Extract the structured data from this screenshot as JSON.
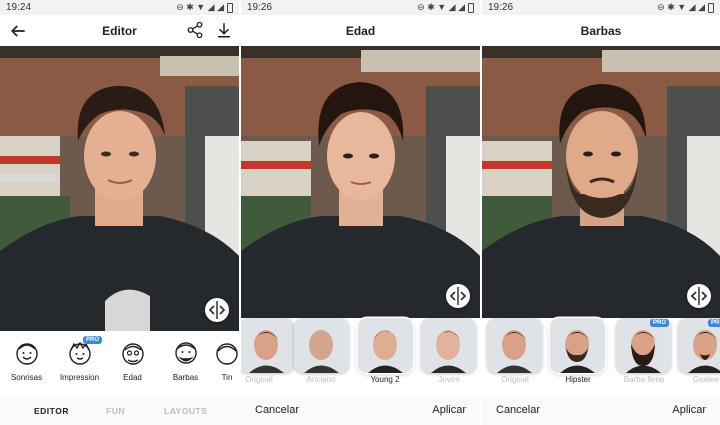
{
  "colors": {
    "accent": "#3b87d8",
    "inactive_text": "#b8bcc6",
    "active_text": "#222222"
  },
  "screens": [
    {
      "time": "19:24",
      "title": "Editor",
      "icons": [
        "back-arrow-icon",
        "share-icon",
        "download-icon",
        "compare-arrows-icon"
      ],
      "tools": [
        {
          "label": "Sonrisas",
          "icon": "smile-face-icon",
          "pro": false
        },
        {
          "label": "Impression",
          "icon": "impression-face-icon",
          "pro": true,
          "pro_label": "PRO"
        },
        {
          "label": "Edad",
          "icon": "age-face-icon",
          "pro": false
        },
        {
          "label": "Barbas",
          "icon": "beard-face-icon",
          "pro": false
        },
        {
          "label": "Tin",
          "icon": "tint-face-icon",
          "pro": false
        }
      ],
      "tabs": [
        {
          "label": "EDITOR",
          "active": true
        },
        {
          "label": "FUN",
          "active": false
        },
        {
          "label": "LAYOUTS",
          "active": false
        }
      ]
    },
    {
      "time": "19:26",
      "title": "Edad",
      "filters": [
        {
          "label": "Original",
          "selected": false
        },
        {
          "label": "Anciano",
          "selected": false
        },
        {
          "label": "Young 2",
          "selected": true
        },
        {
          "label": "Joven",
          "selected": false
        }
      ],
      "cancel": "Cancelar",
      "apply": "Aplicar"
    },
    {
      "time": "19:26",
      "title": "Barbas",
      "filters": [
        {
          "label": "Original",
          "selected": false,
          "pro": false
        },
        {
          "label": "Hipster",
          "selected": true,
          "pro": false
        },
        {
          "label": "Barba llena",
          "selected": false,
          "pro": true,
          "pro_label": "PRO"
        },
        {
          "label": "Goatee",
          "selected": false,
          "pro": true,
          "pro_label": "PRO"
        }
      ],
      "cancel": "Cancelar",
      "apply": "Aplicar"
    }
  ]
}
